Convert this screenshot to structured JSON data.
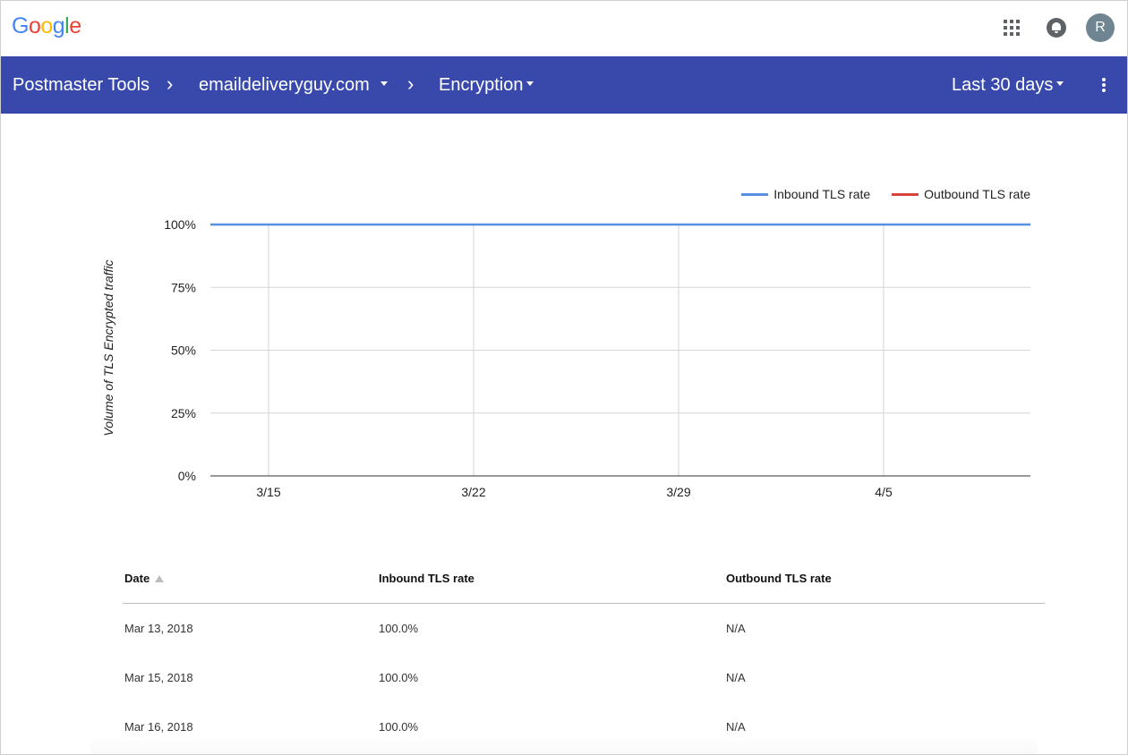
{
  "header": {
    "logo_letters": [
      {
        "char": "G",
        "color": "#4285F4"
      },
      {
        "char": "o",
        "color": "#EA4335"
      },
      {
        "char": "o",
        "color": "#FBBC05"
      },
      {
        "char": "g",
        "color": "#4285F4"
      },
      {
        "char": "l",
        "color": "#34A853"
      },
      {
        "char": "e",
        "color": "#EA4335"
      }
    ],
    "avatar_initial": "R"
  },
  "nav": {
    "app_name": "Postmaster Tools",
    "domain": "emaildeliveryguy.com",
    "section": "Encryption",
    "date_range": "Last 30 days",
    "bar_color": "#3949AB"
  },
  "chart_data": {
    "type": "line",
    "ylabel": "Volume of TLS Encrypted traffic",
    "y_ticks": [
      "0%",
      "25%",
      "50%",
      "75%",
      "100%"
    ],
    "ylim": [
      0,
      100
    ],
    "x_ticks": [
      "3/15",
      "3/22",
      "3/29",
      "4/5"
    ],
    "legend_position": "top-right",
    "grid": true,
    "series": [
      {
        "name": "Inbound TLS rate",
        "color": "#5591E0",
        "values": [
          100,
          100
        ]
      },
      {
        "name": "Outbound TLS rate",
        "color": "#D8453B",
        "values": []
      }
    ]
  },
  "table": {
    "headers": [
      "Date",
      "Inbound TLS rate",
      "Outbound TLS rate"
    ],
    "rows": [
      {
        "date": "Mar 13, 2018",
        "inbound": "100.0%",
        "outbound": "N/A"
      },
      {
        "date": "Mar 15, 2018",
        "inbound": "100.0%",
        "outbound": "N/A"
      },
      {
        "date": "Mar 16, 2018",
        "inbound": "100.0%",
        "outbound": "N/A"
      }
    ]
  }
}
